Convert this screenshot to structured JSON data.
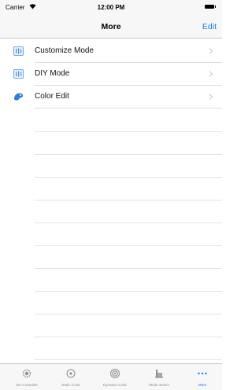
{
  "status_bar": {
    "carrier": "Carrier",
    "time": "12:00 PM"
  },
  "nav": {
    "title": "More",
    "edit_label": "Edit"
  },
  "list": {
    "items": [
      {
        "label": "Customize Mode",
        "icon": "equalizer-icon"
      },
      {
        "label": "DIY Mode",
        "icon": "equalizer-icon"
      },
      {
        "label": "Color Edit",
        "icon": "palette-icon"
      }
    ]
  },
  "tabs": [
    {
      "label": "Set Controller",
      "icon": "gear-icon"
    },
    {
      "label": "Static Color",
      "icon": "eye-icon"
    },
    {
      "label": "Dynamic Color",
      "icon": "circle-target-icon"
    },
    {
      "label": "Mode Select",
      "icon": "building-icon"
    },
    {
      "label": "More",
      "icon": "more-dots-icon",
      "active": true
    }
  ],
  "colors": {
    "accent": "#1a7ee6",
    "icon_blue": "#4a90e2",
    "inactive": "#8e8e93"
  }
}
